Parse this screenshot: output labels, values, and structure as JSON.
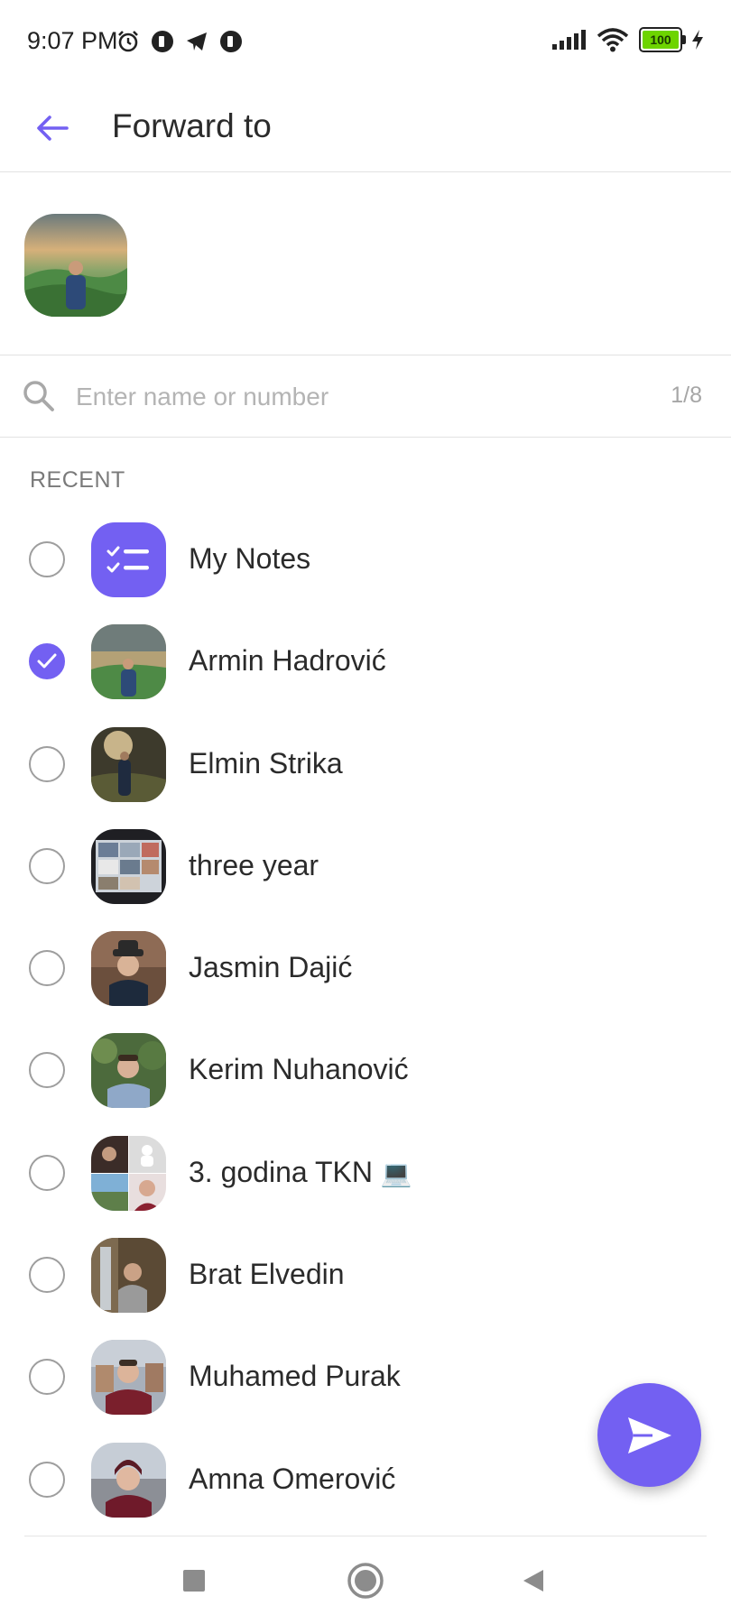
{
  "status_bar": {
    "time": "9:07 PM",
    "battery_level": "100",
    "icons_left": [
      "alarm-icon",
      "app-notification-icon",
      "telegram-icon",
      "app-notification-icon"
    ],
    "icons_right": [
      "signal-icon",
      "wifi-icon",
      "battery-icon",
      "charging-icon"
    ]
  },
  "app_bar": {
    "back_icon": "arrow-left-icon",
    "title": "Forward to"
  },
  "search": {
    "placeholder": "Enter name or number",
    "value": "",
    "count": "1/8"
  },
  "section_header": "RECENT",
  "contacts": [
    {
      "name": "My Notes",
      "checked": false,
      "avatar": "notes-icon"
    },
    {
      "name": "Armin Hadrović",
      "checked": true,
      "avatar": "photo"
    },
    {
      "name": "Elmin Strika",
      "checked": false,
      "avatar": "photo"
    },
    {
      "name": "three year",
      "checked": false,
      "avatar": "photo"
    },
    {
      "name": "Jasmin Dajić",
      "checked": false,
      "avatar": "photo"
    },
    {
      "name": "Kerim Nuhanović",
      "checked": false,
      "avatar": "photo"
    },
    {
      "name": "3. godina TKN",
      "emoji": "💻",
      "checked": false,
      "avatar": "photo-collage"
    },
    {
      "name": "Brat Elvedin",
      "checked": false,
      "avatar": "photo"
    },
    {
      "name": "Muhamed Purak",
      "checked": false,
      "avatar": "photo"
    },
    {
      "name": "Amna Omerović",
      "checked": false,
      "avatar": "photo"
    }
  ],
  "fab": {
    "icon": "send-icon"
  },
  "nav_bar": {
    "icons": [
      "recents-square-icon",
      "home-circle-icon",
      "back-triangle-icon"
    ]
  },
  "colors": {
    "accent": "#7360f2",
    "divider": "#e2e2e2",
    "text": "#2b2b2b",
    "muted": "#7a7a7a"
  }
}
